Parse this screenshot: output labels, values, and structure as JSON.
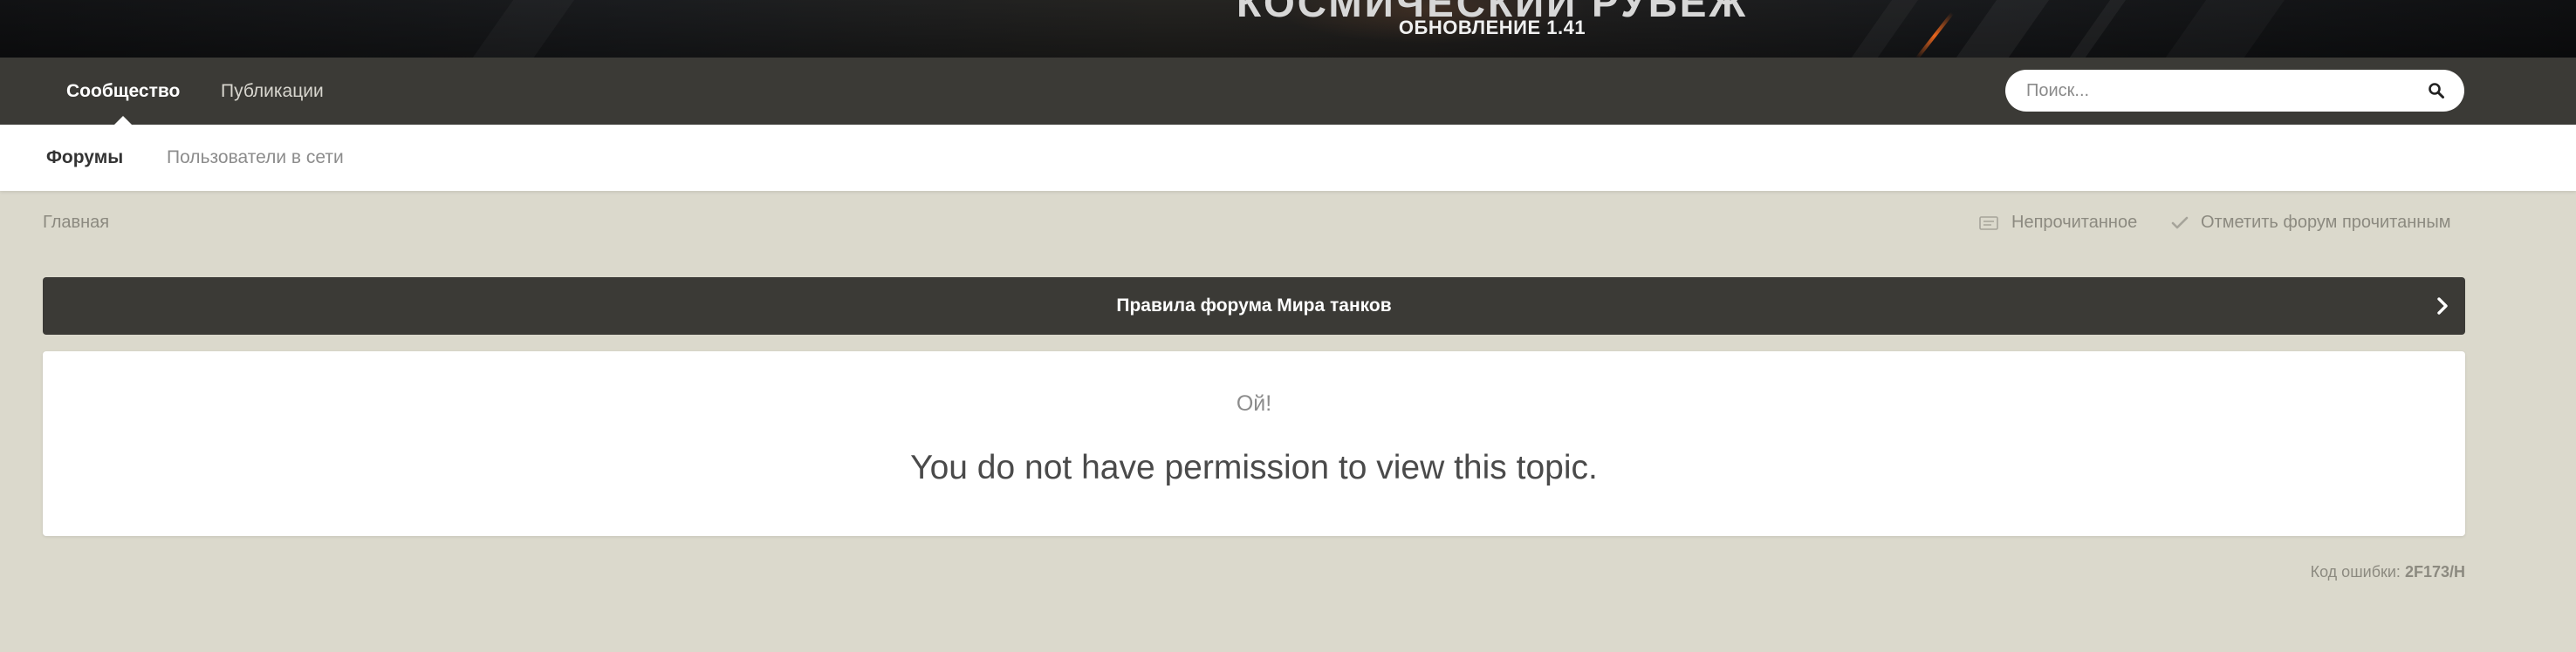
{
  "banner": {
    "title": "КОСМИЧЕСКИЙ РУБЕЖ",
    "subtitle": "ОБНОВЛЕНИЕ 1.41"
  },
  "primary_nav": {
    "tabs": [
      {
        "label": "Сообщество",
        "active": true
      },
      {
        "label": "Публикации",
        "active": false
      }
    ],
    "search": {
      "placeholder": "Поиск...",
      "value": ""
    }
  },
  "secondary_nav": {
    "tabs": [
      {
        "label": "Форумы",
        "active": true
      },
      {
        "label": "Пользователи в сети",
        "active": false
      }
    ]
  },
  "breadcrumb": {
    "home": "Главная"
  },
  "actions": {
    "unread": {
      "label": "Непрочитанное",
      "icon": "unread-icon"
    },
    "mark_read": {
      "label": "Отметить форум прочитанным",
      "icon": "checkmark-icon"
    }
  },
  "rules_bar": {
    "label": "Правила форума Мира танков"
  },
  "error": {
    "oops": "Ой!",
    "message": "You do not have permission to view this topic.",
    "code_label": "Код ошибки:",
    "code_value": "2F173/H"
  },
  "colors": {
    "page_bg": "#dbd9cc",
    "nav_bg": "#3b3a36",
    "card_bg": "#ffffff"
  }
}
